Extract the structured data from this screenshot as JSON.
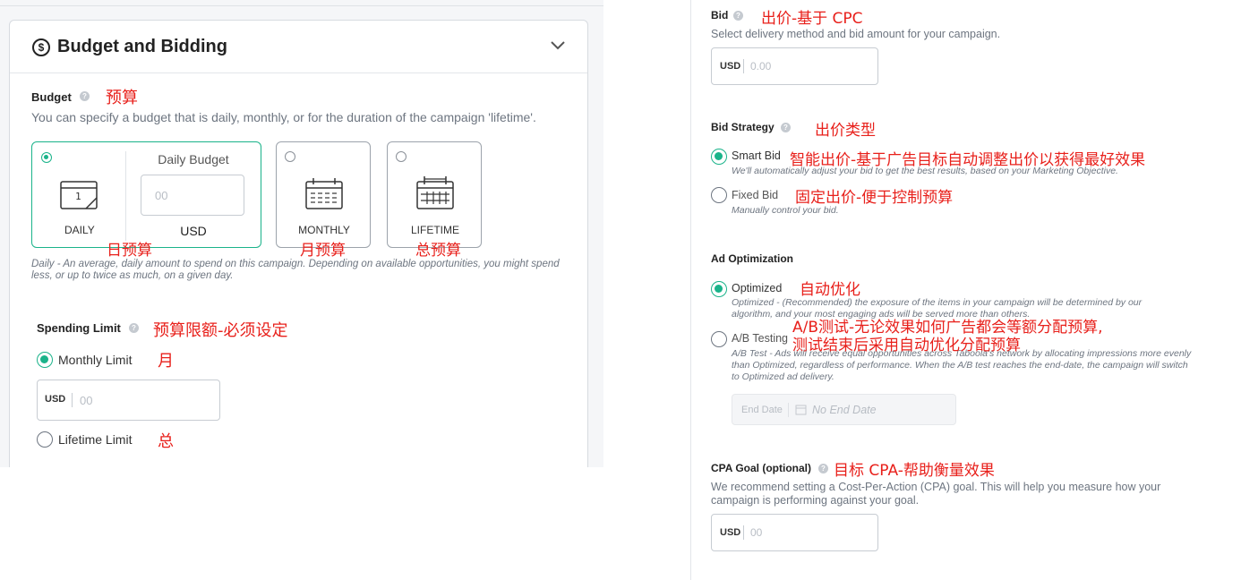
{
  "left": {
    "section_title": "Budget and Bidding",
    "budget": {
      "label": "Budget",
      "annotation": "预算",
      "description": "You can specify a budget that is daily, monthly, or for the duration of the campaign 'lifetime'.",
      "options": [
        {
          "label": "DAILY",
          "annotation": "日预算",
          "selected": true
        },
        {
          "label": "MONTHLY",
          "annotation": "月预算",
          "selected": false
        },
        {
          "label": "LIFETIME",
          "annotation": "总预算",
          "selected": false
        }
      ],
      "daily_budget_title": "Daily Budget",
      "daily_budget_placeholder": "00",
      "currency": "USD",
      "calendar_day": "1",
      "note": "Daily - An average, daily amount to spend on this campaign. Depending on available opportunities, you might spend less, or up to twice as much, on a given day."
    },
    "spending_limit": {
      "label": "Spending Limit",
      "annotation": "预算限额-必须设定",
      "monthly_label": "Monthly Limit",
      "monthly_annotation": "月",
      "monthly_selected": true,
      "currency": "USD",
      "placeholder": "00",
      "lifetime_label": "Lifetime Limit",
      "lifetime_annotation": "总"
    }
  },
  "right": {
    "bid": {
      "label": "Bid",
      "annotation": "出价-基于 CPC",
      "description": "Select delivery method and bid amount for your campaign.",
      "currency": "USD",
      "placeholder": "0.00"
    },
    "bid_strategy": {
      "label": "Bid Strategy",
      "annotation": "出价类型",
      "smart_label": "Smart Bid",
      "smart_annotation": "智能出价-基于广告目标自动调整出价以获得最好效果",
      "smart_desc": "We'll automatically adjust your bid to get the best results, based on your Marketing Objective.",
      "smart_selected": true,
      "fixed_label": "Fixed Bid",
      "fixed_annotation": "固定出价-便于控制预算",
      "fixed_desc": "Manually control your bid."
    },
    "ad_optimization": {
      "label": "Ad Optimization",
      "optimized_label": "Optimized",
      "optimized_annotation": "自动优化",
      "optimized_selected": true,
      "optimized_desc": "Optimized - (Recommended) the exposure of the items in your campaign will be determined by our algorithm, and your most engaging ads will be served more than others.",
      "ab_label": "A/B Testing",
      "ab_annotation_line1": "A/B测试-无论效果如何广告都会等额分配预算,",
      "ab_annotation_line2": "测试结束后采用自动优化分配预算",
      "ab_desc": "A/B Test - Ads will receive equal opportunities across Taboola's network by allocating impressions more evenly than Optimized, regardless of performance. When the A/B test reaches the end-date, the campaign will switch to Optimized ad delivery.",
      "end_date_label": "End Date",
      "end_date_value": "No End Date"
    },
    "cpa_goal": {
      "label": "CPA Goal (optional)",
      "annotation": "目标 CPA-帮助衡量效果",
      "description": "We recommend setting a Cost-Per-Action (CPA) goal. This will help you measure how your campaign is performing against your goal.",
      "currency": "USD",
      "placeholder": "00"
    }
  },
  "colors": {
    "accent": "#1ab38a",
    "annotation": "#e8201b",
    "border": "#d7dbe0"
  }
}
